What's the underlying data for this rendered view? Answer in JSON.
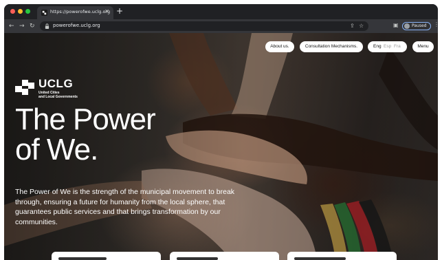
{
  "browser": {
    "tab_title": "https://powerofwe.uclg.org",
    "tab_close": "✕",
    "new_tab": "+",
    "back": "←",
    "forward": "→",
    "reload": "↻",
    "url": "powerofwe.uclg.org",
    "profile_status": "Paused",
    "menu": "⋮"
  },
  "site_nav": {
    "about": "About us.",
    "consultation": "Consultation Mechanisms.",
    "languages": [
      "Eng",
      "Esp",
      "Fra"
    ],
    "menu": "Menu"
  },
  "logo": {
    "name": "UCLG",
    "subtitle_line1": "United Cities",
    "subtitle_line2": "and Local Governments"
  },
  "hero": {
    "title_line1": "The Power",
    "title_line2": "of We.",
    "description": "The Power of We is the strength of the municipal movement to break through, ensuring a future for humanity from the local sphere, that guarantees public services and that brings transformation by our communities."
  }
}
